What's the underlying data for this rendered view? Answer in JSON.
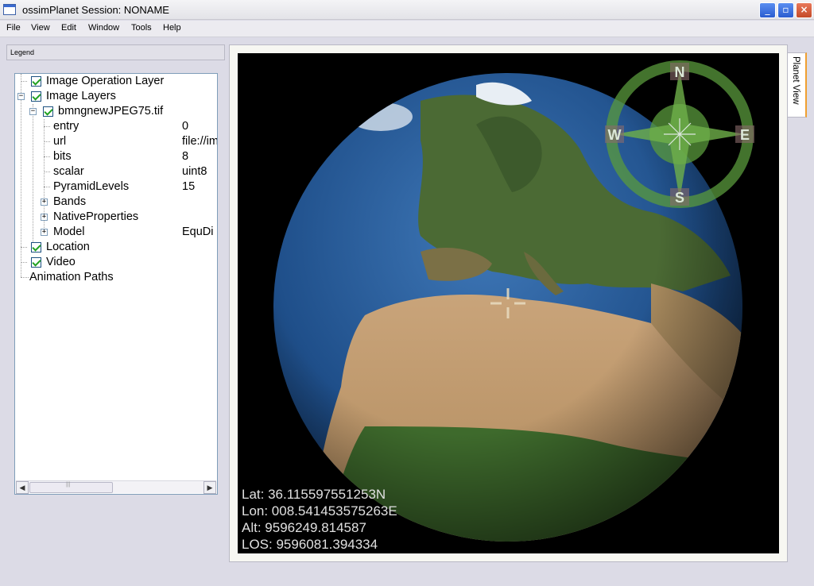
{
  "window": {
    "title": "ossimPlanet Session: NONAME",
    "controls": {
      "minimize": "_",
      "restore": "▫",
      "close": "×"
    }
  },
  "menu": [
    "File",
    "View",
    "Edit",
    "Window",
    "Tools",
    "Help"
  ],
  "legend": {
    "title": "Legend",
    "tree": {
      "image_operation_layer": "Image Operation Layer",
      "image_layers": "Image Layers",
      "file": "bmngnewJPEG75.tif",
      "props": [
        {
          "key": "entry",
          "value": "0"
        },
        {
          "key": "url",
          "value": "file://im"
        },
        {
          "key": "bits",
          "value": "8"
        },
        {
          "key": "scalar",
          "value": "uint8"
        },
        {
          "key": "PyramidLevels",
          "value": "15"
        }
      ],
      "bands": "Bands",
      "native_properties": "NativeProperties",
      "model": {
        "key": "Model",
        "value": "EquDi"
      },
      "location": "Location",
      "video": "Video",
      "animation_paths": "Animation Paths"
    }
  },
  "planet_view": {
    "tab_label": "Planet View",
    "compass": {
      "n": "N",
      "e": "E",
      "s": "S",
      "w": "W"
    },
    "readout": {
      "lat": "Lat: 36.115597551253N",
      "lon": "Lon: 008.541453575263E",
      "alt": "Alt: 9596249.814587",
      "los": "LOS: 9596081.394334"
    }
  },
  "colors": {
    "accent": "#f0a030",
    "compass_green": "#5a9a3c",
    "checkmark": "#21a121"
  }
}
